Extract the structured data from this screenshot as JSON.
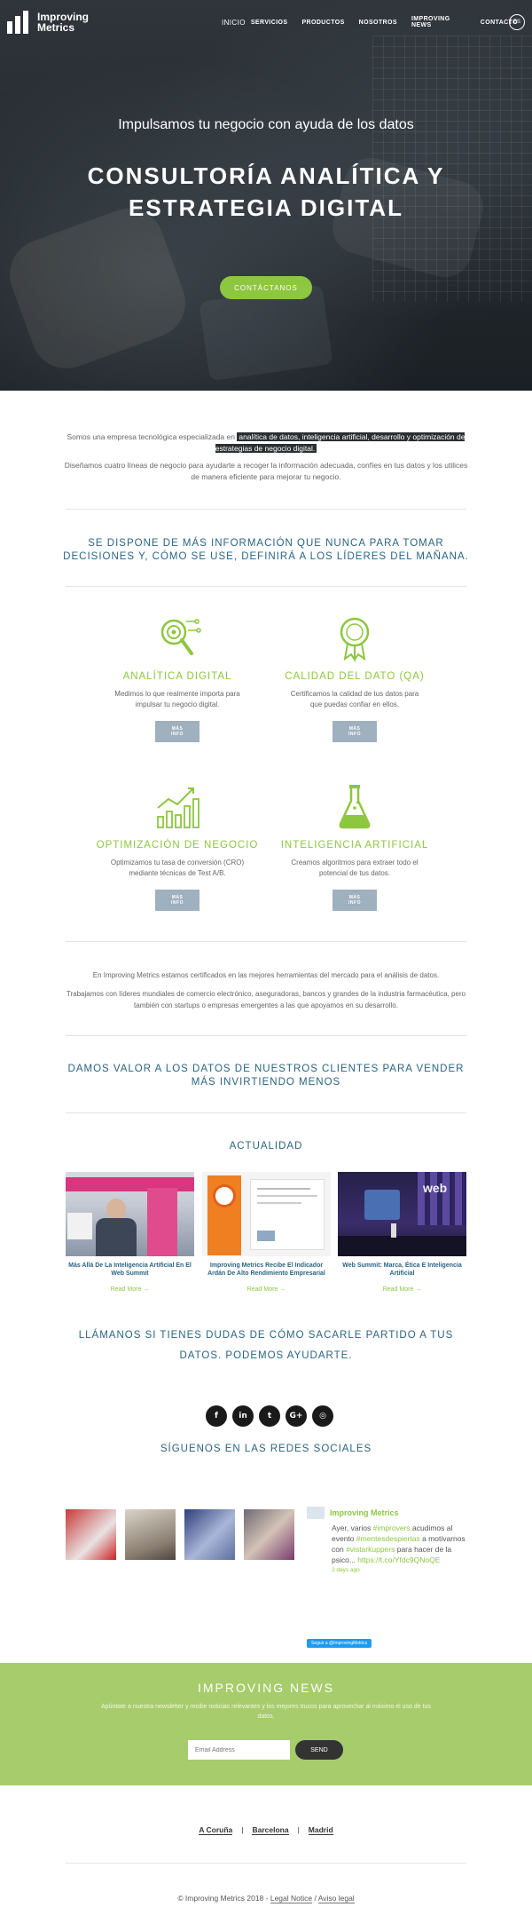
{
  "header": {
    "logo_text_1": "Improving",
    "logo_text_2": "Metrics",
    "nav": [
      "INICIO",
      "SERVICIOS",
      "PRODUCTOS",
      "NOSOTROS",
      "IMPROVING NEWS",
      "CONTACTO"
    ],
    "lang": "ES"
  },
  "hero": {
    "subtitle": "Impulsamos tu negocio con ayuda de los datos",
    "title": "CONSULTORÍA ANALÍTICA Y ESTRATEGIA DIGITAL",
    "cta": "CONTÁCTANOS"
  },
  "intro": {
    "p1_start": "Somos una empresa tecnológica especializada en ",
    "p1_highlight": "analítica de datos, inteligencia artificial, desarrollo y optimización de estrategias de negocio digital.",
    "p2": "Diseñamos cuatro líneas de negocio para ayudarte a recoger la información adecuada, confíes en tus datos y los utilices de manera eficiente para mejorar tu negocio."
  },
  "quote1": "SE DISPONE DE MÁS INFORMACIÓN QUE NUNCA PARA TOMAR DECISIONES Y, CÓMO SE USE, DEFINIRÁ A LOS LÍDERES DEL MAÑANA.",
  "services": [
    {
      "icon": "target-magnifier-icon",
      "title": "ANALÍTICA DIGITAL",
      "text": "Medimos lo que realmente importa para impulsar tu negocio digital.",
      "more": "MÁS INFO"
    },
    {
      "icon": "award-badge-icon",
      "title": "CALIDAD DEL DATO (QA)",
      "text": "Certificamos la calidad de tus datos para que puedas confiar en ellos.",
      "more": "MÁS INFO"
    },
    {
      "icon": "bar-chart-growth-icon",
      "title": "OPTIMIZACIÓN DE NEGOCIO",
      "text": "Optimizamos tu tasa de conversión (CRO) mediante técnicas de Test A/B.",
      "more": "MÁS INFO"
    },
    {
      "icon": "flask-icon",
      "title": "INTELIGENCIA ARTIFICIAL",
      "text": "Creamos algoritmos para extraer todo el potencial de tus datos.",
      "more": "MÁS INFO"
    }
  ],
  "certs": {
    "p1": "En Improving Metrics estamos certificados en las mejores herramientas del mercado para el análisis de datos.",
    "p2": "Trabajamos con líderes mundiales de comercio electrónico, aseguradoras, bancos y grandes de la industria farmacéutica, pero también con startups o empresas emergentes a las que apoyamos en su desarrollo."
  },
  "quote2": "DAMOS VALOR A LOS DATOS DE NUESTROS CLIENTES PARA VENDER MÁS INVIRTIENDO MENOS",
  "news": {
    "title": "ACTUALIDAD",
    "items": [
      {
        "caption": "Más Allá De La Inteligencia Artificial En El Web Summit",
        "more": "Read More →"
      },
      {
        "caption": "Improving Metrics Recibe El Indicador Ardán De Alto Rendimiento Empresarial",
        "more": "Read More →"
      },
      {
        "caption": "Web Summit: Marca, Ética E Inteligencia Artificial",
        "more": "Read More →"
      }
    ]
  },
  "call": "LLÁMANOS SI TIENES DUDAS DE CÓMO SACARLE PARTIDO A TUS DATOS. PODEMOS AYUDARTE.",
  "social": {
    "icons": [
      "facebook-icon",
      "linkedin-icon",
      "twitter-icon",
      "google-plus-icon",
      "instagram-icon"
    ],
    "glyphs": [
      "f",
      "in",
      "t",
      "G+",
      "◎"
    ],
    "title": "SÍGUENOS EN LAS REDES SOCIALES"
  },
  "tweet": {
    "name": "Improving Metrics",
    "text_1": "Ayer, varios ",
    "tag_1": "#improvers",
    "text_2": " acudimos al evento ",
    "tag_2": "#mentesdespiertas",
    "text_3": " a motivarnos con ",
    "tag_3": "#vistarkuppers",
    "text_4": " para hacer de la psico... ",
    "link": "https://t.co/Yfdc9QNoQE",
    "time": "2 days ago",
    "follow": "Seguir a @ImprovingMetrics"
  },
  "newsletter": {
    "title": "IMPROVING NEWS",
    "text": "Apúntate a nuestra newsletter y recibe noticias relevantes y los mejores trucos para aprovechar al máximo el uso de tus datos.",
    "placeholder": "Email Address",
    "send": "SEND"
  },
  "cities": [
    "A Coruña",
    "Barcelona",
    "Madrid"
  ],
  "footer": {
    "copy": "© Improving Metrics 2018 - ",
    "legal": "Legal Notice",
    "slash": " / ",
    "aviso": "Aviso legal"
  },
  "colors": {
    "green": "#8dc63f",
    "blue": "#2a6483",
    "newsletter": "#a7cc6b"
  }
}
